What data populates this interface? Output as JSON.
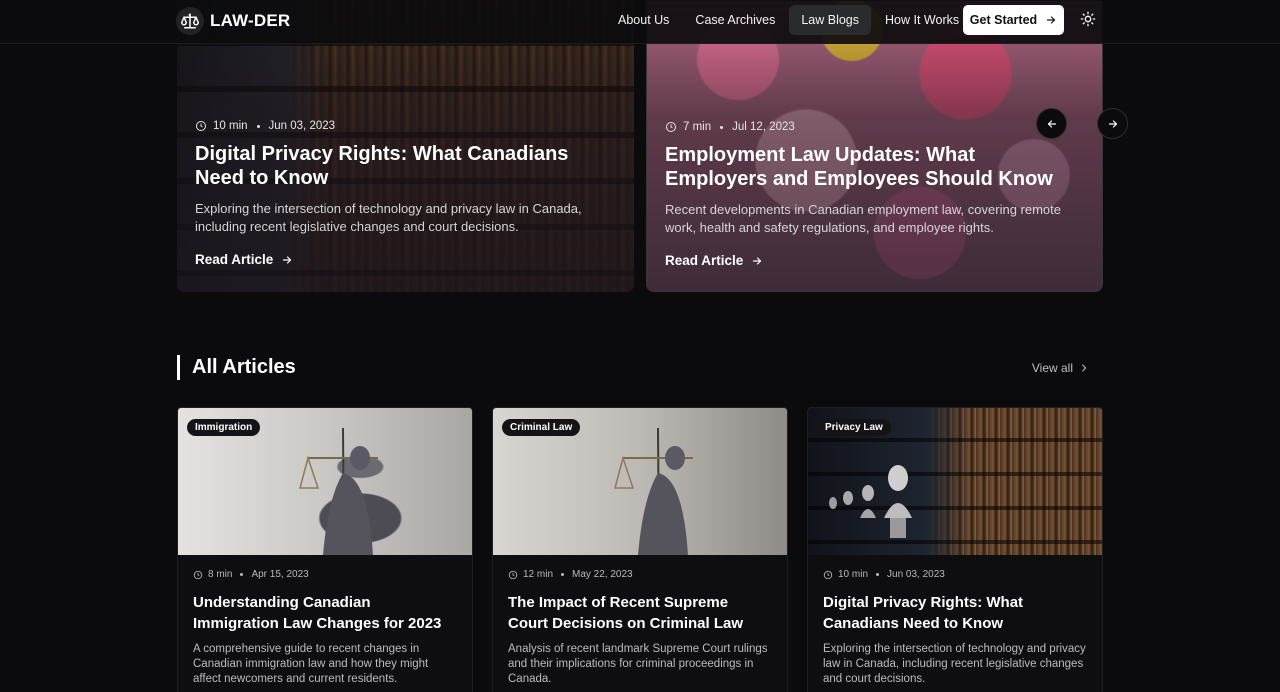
{
  "nav": {
    "brand": "LAW-DER",
    "links": [
      {
        "label": "About Us",
        "active": false
      },
      {
        "label": "Case Archives",
        "active": false
      },
      {
        "label": "Law Blogs",
        "active": true
      },
      {
        "label": "How It Works",
        "active": false
      }
    ],
    "cta_label": "Get Started"
  },
  "featured": [
    {
      "read_time": "10 min",
      "date": "Jun 03, 2023",
      "title": "Digital Privacy Rights: What Canadians Need to Know",
      "description": "Exploring the intersection of technology and privacy law in Canada, including recent legislative changes and court decisions.",
      "link_label": "Read Article"
    },
    {
      "read_time": "7 min",
      "date": "Jul 12, 2023",
      "title": "Employment Law Updates: What Employers and Employees Should Know",
      "description": "Recent developments in Canadian employment law, covering remote work, health and safety regulations, and employee rights.",
      "link_label": "Read Article"
    }
  ],
  "articles_section": {
    "title": "All Articles",
    "view_all": "View all"
  },
  "articles": [
    {
      "tag": "Immigration",
      "read_time": "8 min",
      "date": "Apr 15, 2023",
      "title": "Understanding Canadian Immigration Law Changes for 2023",
      "description": "A comprehensive guide to recent changes in Canadian immigration law and how they might affect newcomers and current residents."
    },
    {
      "tag": "Criminal Law",
      "read_time": "12 min",
      "date": "May 22, 2023",
      "title": "The Impact of Recent Supreme Court Decisions on Criminal Law",
      "description": "Analysis of recent landmark Supreme Court rulings and their implications for criminal proceedings in Canada."
    },
    {
      "tag": "Privacy Law",
      "read_time": "10 min",
      "date": "Jun 03, 2023",
      "title": "Digital Privacy Rights: What Canadians Need to Know",
      "description": "Exploring the intersection of technology and privacy law in Canada, including recent legislative changes and court decisions."
    }
  ],
  "icons": {
    "logo": "scales-icon",
    "cta": "arrow-right-icon",
    "theme": "sun-icon",
    "meta": "clock-icon",
    "carousel_prev": "arrow-left-icon",
    "carousel_next": "arrow-right-icon",
    "view_all": "chevron-right-icon"
  }
}
